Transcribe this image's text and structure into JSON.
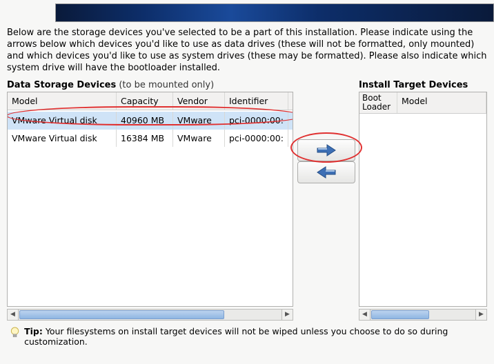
{
  "intro": "Below are the storage devices you've selected to be a part of this installation.  Please indicate using the arrows below which devices you'd like to use as data drives (these will not be formatted, only mounted) and which devices you'd like to use as system drives (these may be formatted).  Please also indicate which system drive will have the bootloader installed.",
  "left": {
    "title": "Data Storage Devices",
    "subtitle": "(to be mounted only)",
    "columns": {
      "c0": "Model",
      "c1": "Capacity",
      "c2": "Vendor",
      "c3": "Identifier"
    },
    "rows": [
      {
        "model": "VMware Virtual disk",
        "capacity": "40960 MB",
        "vendor": "VMware",
        "identifier": "pci-0000:00:",
        "selected": true
      },
      {
        "model": "VMware Virtual disk",
        "capacity": "16384 MB",
        "vendor": "VMware",
        "identifier": "pci-0000:00:",
        "selected": false
      }
    ]
  },
  "right": {
    "title": "Install Target Devices",
    "columns": {
      "c0_l1": "Boot",
      "c0_l2": "Loader",
      "c1": "Model"
    }
  },
  "tip": {
    "label": "Tip:",
    "text": "Your filesystems on install target devices will not be wiped unless you choose to do so during customization."
  },
  "icons": {
    "arrow_right_color": "#3d6fb5",
    "arrow_left_color": "#3d6fb5"
  }
}
